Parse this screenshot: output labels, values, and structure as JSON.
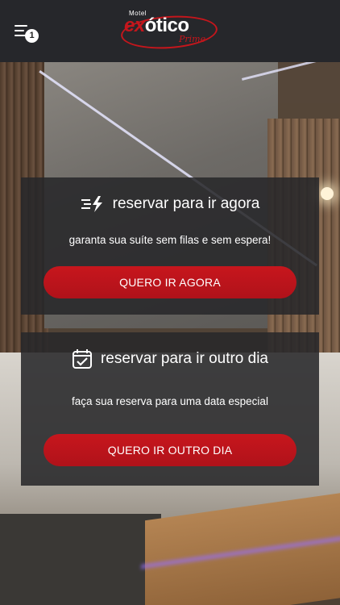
{
  "header": {
    "menu_badge": "1",
    "logo": {
      "top_text": "Motel",
      "word_prefix": "ex",
      "word_rest": "ótico",
      "sub_text": "Prime",
      "brand_color": "#c4161c"
    }
  },
  "cards": [
    {
      "icon": "lightning-speed-icon",
      "title": "reservar para ir agora",
      "subtitle": "garanta sua suíte sem filas e sem espera!",
      "button_label": "QUERO IR AGORA"
    },
    {
      "icon": "calendar-check-icon",
      "title": "reservar para ir outro dia",
      "subtitle": "faça sua reserva para uma data especial",
      "button_label": "QUERO IR OUTRO DIA"
    }
  ],
  "colors": {
    "header_bg": "#26272b",
    "card_bg": "#28282a",
    "button_red": "#c7161d"
  }
}
